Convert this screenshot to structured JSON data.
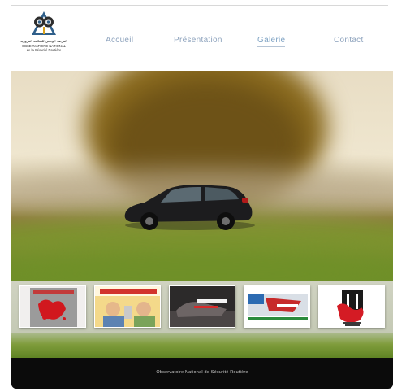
{
  "logo": {
    "arabic_line": "المرصد الوطني للسلامة المرورية",
    "line1": "OBSERVATOIRE NATIONAL",
    "line2": "de la Sécurité Routière",
    "line3": ""
  },
  "nav": {
    "items": [
      {
        "label": "Accueil"
      },
      {
        "label": "Présentation"
      },
      {
        "label": "Galerie"
      },
      {
        "label": "Contact"
      }
    ],
    "active_index": 2
  },
  "footer": {
    "text": "Observatoire National de Sécurité Routière"
  },
  "colors": {
    "nav_text": "#8fa4be",
    "footer_bg": "#0b0b0b"
  }
}
